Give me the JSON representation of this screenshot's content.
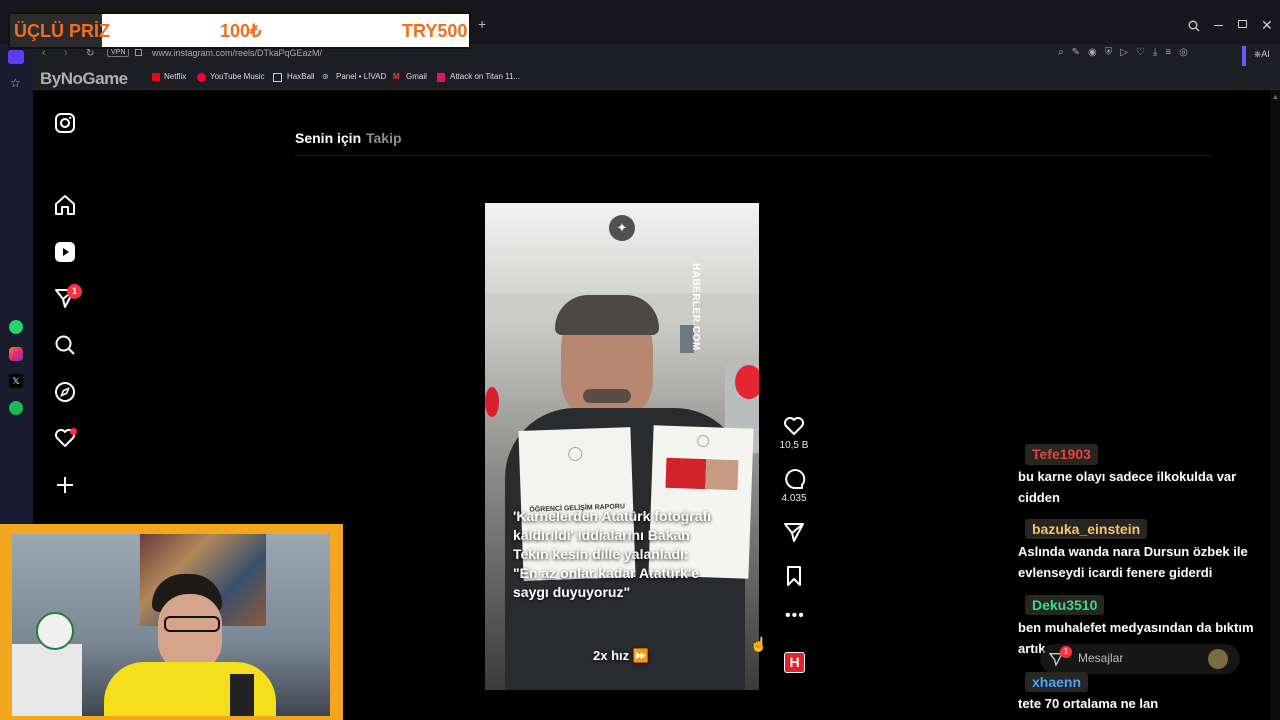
{
  "promo": {
    "left": "ÜÇLÜ PRİZ",
    "price": "100₺",
    "right": "TRY500"
  },
  "browser": {
    "url": "www.instagram.com/reels/DTkaPqGEazM/",
    "vpn": "VPN",
    "watermark": "ByNoGame",
    "bookmarks": [
      "Netflix",
      "YouTube Music",
      "HaxBall",
      "Panel • LİVAD",
      "Gmail",
      "Attack on Titan 11..."
    ]
  },
  "tabs": {
    "for_you": "Senin için",
    "following": "Takip"
  },
  "nav": {
    "messages_badge": "1"
  },
  "video": {
    "watermark": "HABERLER.COM",
    "doc_left_title": "ÖĞRENCİ GELİŞİM RAPORU",
    "caption": [
      "'Karnelerden Atatürk fotoğrafı",
      "kaldırıldı' iddialarını Bakan",
      "Tekin kesin dille yalanladı:",
      "\"En az onlar kadar Atatürk'e",
      "saygı duyuyoruz\""
    ],
    "speed": "2x hız"
  },
  "actions": {
    "likes": "10,5 B",
    "comments": "4.035",
    "brand_badge": "H"
  },
  "messages_bar": {
    "label": "Mesajlar",
    "badge": "1"
  },
  "chat": [
    {
      "user": "Tefe1903",
      "user_color": "#e8443a",
      "text": "bu karne olayı sadece ilkokulda var cidden"
    },
    {
      "user": "bazuka_einstein",
      "user_color": "#f5c26b",
      "text": "Aslında wanda nara Dursun özbek ile evlenseydi icardi fenere giderdi"
    },
    {
      "user": "Deku3510",
      "user_color": "#3ddc84",
      "text": "ben muhalefet medyasından da bıktım artık"
    },
    {
      "user": "xhaenn",
      "user_color": "#4aa3ff",
      "text": "tete 70 ortalama ne lan"
    }
  ]
}
